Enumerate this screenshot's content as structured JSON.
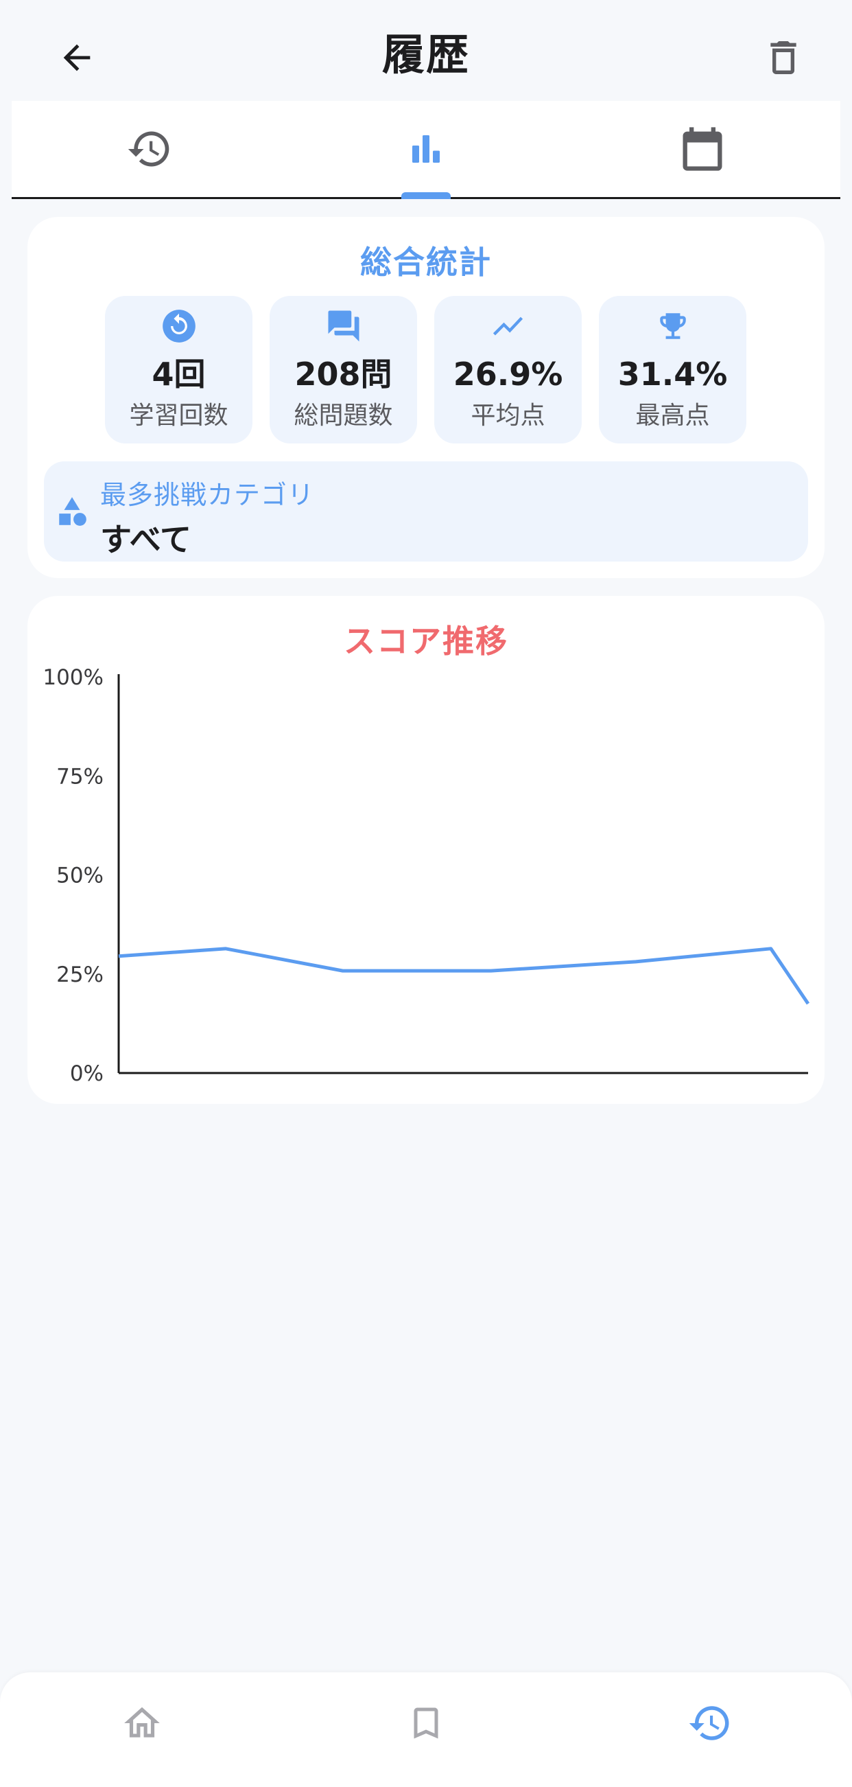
{
  "header": {
    "title": "履歴"
  },
  "tabs": [
    {
      "icon": "history-icon",
      "active": false
    },
    {
      "icon": "bar-chart-icon",
      "active": true
    },
    {
      "icon": "calendar-icon",
      "active": false
    }
  ],
  "stats": {
    "title": "総合統計",
    "tiles": [
      {
        "icon": "replay-icon",
        "value": "4回",
        "label": "学習回数"
      },
      {
        "icon": "chat-icon",
        "value": "208問",
        "label": "総問題数"
      },
      {
        "icon": "trending-icon",
        "value": "26.9%",
        "label": "平均点"
      },
      {
        "icon": "trophy-icon",
        "value": "31.4%",
        "label": "最高点"
      }
    ],
    "category": {
      "icon": "category-shapes-icon",
      "label": "最多挑戦カテゴリ",
      "value": "すべて"
    }
  },
  "chart_data": {
    "type": "line",
    "title": "スコア推移",
    "xlabel": "",
    "ylabel": "",
    "ylim": [
      0,
      100
    ],
    "yticks": [
      "0%",
      "25%",
      "50%",
      "75%",
      "100%"
    ],
    "yticks_values": [
      0,
      25,
      50,
      75,
      100
    ],
    "grid": false,
    "series": [
      {
        "color": "#5b9cf0",
        "x": [
          0,
          1,
          2,
          3,
          4,
          5,
          6
        ],
        "values": [
          29.5,
          31.4,
          25.8,
          25.8,
          28.1,
          31.4,
          17.5
        ]
      }
    ],
    "x_positions": [
      0,
      0.155,
      0.325,
      0.54,
      0.75,
      0.946,
      1.0
    ]
  },
  "bottom_nav": [
    {
      "icon": "home-icon",
      "active": false
    },
    {
      "icon": "bookmark-icon",
      "active": false
    },
    {
      "icon": "history-icon",
      "active": true
    }
  ],
  "colors": {
    "accent": "#5b9cf0",
    "chart_title": "#f06a6e",
    "inactive_icon": "#6e6e73",
    "nav_inactive": "#a8a8ad"
  }
}
